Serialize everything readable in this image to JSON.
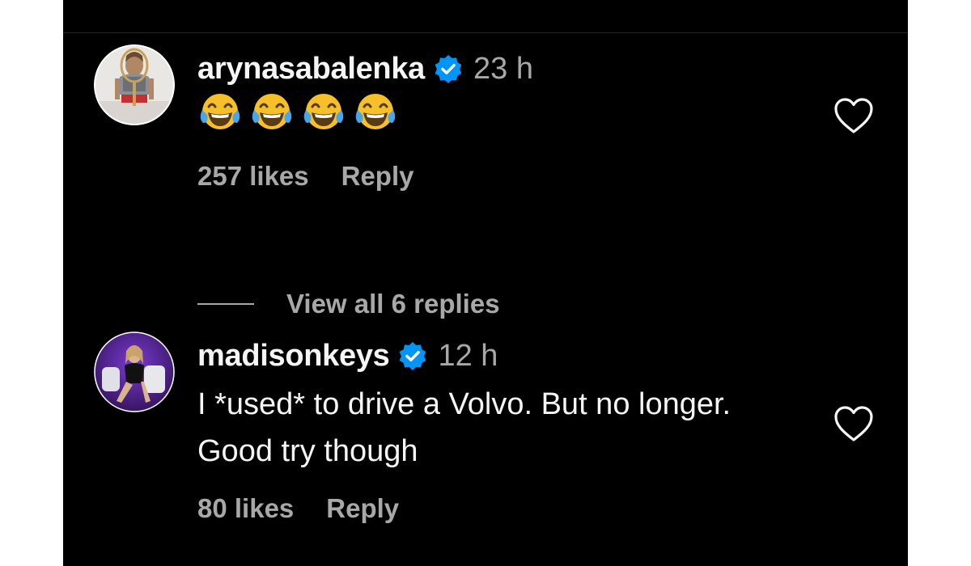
{
  "comments": [
    {
      "username": "arynasabalenka",
      "time": "23 h",
      "emojis": [
        "😂",
        "😂",
        "😂",
        "😂"
      ],
      "likes": "257 likes",
      "reply_label": "Reply",
      "avatar_icon": "avatar-photo"
    },
    {
      "username": "madisonkeys",
      "time": "12 h",
      "text": "I *used* to drive a Volvo. But no longer. Good try though",
      "likes": "80 likes",
      "reply_label": "Reply",
      "avatar_icon": "avatar-photo"
    }
  ],
  "view_replies": "View all 6 replies",
  "colors": {
    "background": "#000000",
    "primary_text": "#f5f5f5",
    "secondary_text": "#a8a8a8",
    "verified_blue": "#0095f6"
  },
  "icons": [
    "verified-badge-icon",
    "heart-icon",
    "tears-of-joy-emoji"
  ]
}
